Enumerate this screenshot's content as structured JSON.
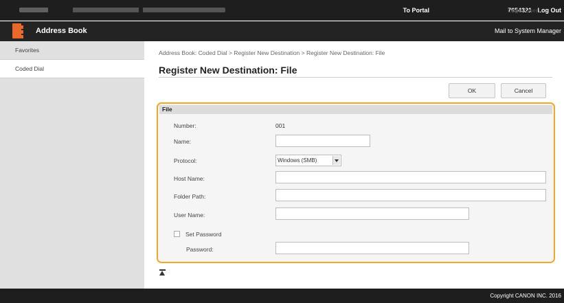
{
  "topbar": {
    "portal_link": "To Portal",
    "login_label": "Login User:",
    "login_user": "7654321",
    "logout": "Log Out"
  },
  "app": {
    "title": "Address Book",
    "mail_link": "Mail to System Manager",
    "accent": "#e8692a"
  },
  "sidebar": {
    "items": [
      {
        "label": "Favorites"
      },
      {
        "label": "Coded Dial"
      }
    ]
  },
  "main": {
    "breadcrumb": "Address Book: Coded Dial > Register New Destination > Register New Destination: File",
    "title": "Register New Destination: File",
    "ok_label": "OK",
    "cancel_label": "Cancel"
  },
  "file_section": {
    "header": "File",
    "highlight_color": "#f0a826",
    "number_label": "Number:",
    "number_value": "001",
    "name_label": "Name:",
    "name_value": "",
    "protocol_label": "Protocol:",
    "protocol_value": "Windows (SMB)",
    "host_label": "Host Name:",
    "host_value": "",
    "folder_label": "Folder Path:",
    "folder_value": "",
    "user_label": "User Name:",
    "user_value": "",
    "set_password_label": "Set Password",
    "password_label": "Password:",
    "password_value": ""
  },
  "footer": {
    "copyright": "Copyright CANON INC. 2016"
  }
}
